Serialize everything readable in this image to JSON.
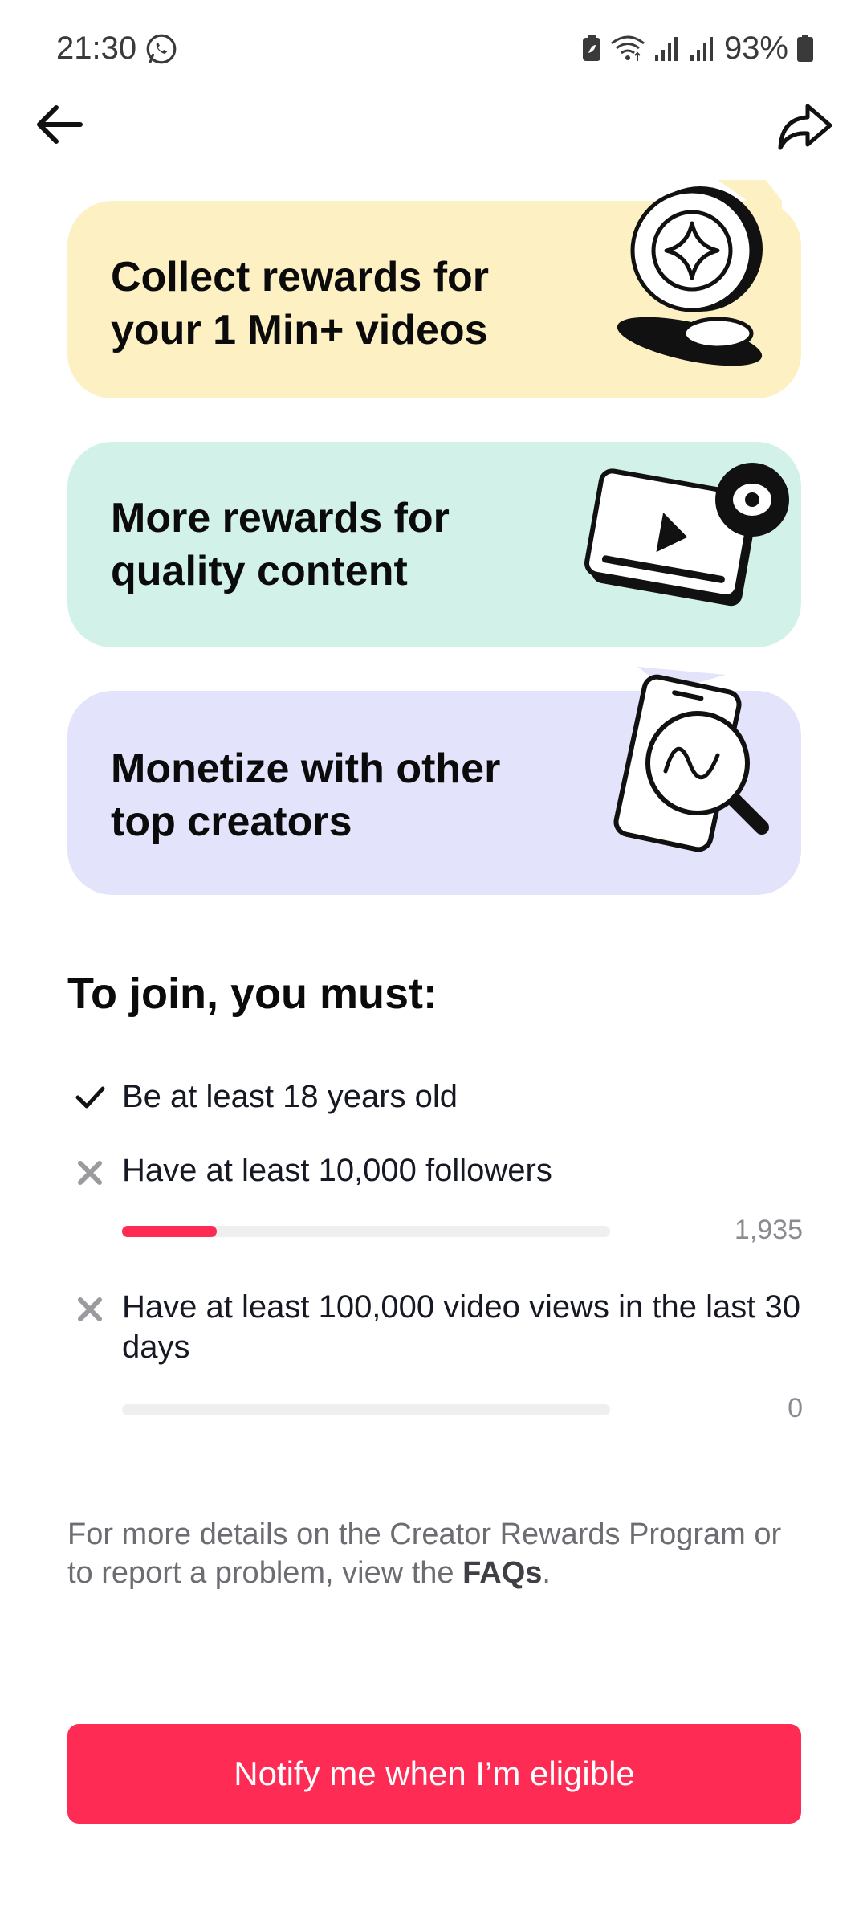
{
  "status_bar": {
    "time": "21:30",
    "battery": "93%",
    "icons": [
      "whatsapp-icon",
      "battery-saver-icon",
      "wifi-icon",
      "signal-icon",
      "signal-icon",
      "battery-icon"
    ]
  },
  "nav": {
    "back_icon": "arrow-left-icon",
    "share_icon": "share-arrow-icon"
  },
  "cards": [
    {
      "title": "Collect rewards for your 1 Min+ videos",
      "color": "#fdf0c3",
      "illustration": "coins-icon"
    },
    {
      "title": "More rewards for quality content",
      "color": "#d2f2e9",
      "illustration": "video-eye-icon"
    },
    {
      "title": "Monetize with other top creators",
      "color": "#e3e3fb",
      "illustration": "phone-magnifier-icon"
    }
  ],
  "requirements": {
    "title": "To join, you must:",
    "items": [
      {
        "text": "Be at least 18 years old",
        "status": "met",
        "icon": "check-icon"
      },
      {
        "text": "Have at least 10,000 followers",
        "status": "unmet",
        "icon": "cross-icon",
        "progress_value": "1,935",
        "progress_fraction": 0.1935
      },
      {
        "text": "Have at least 100,000 video views in the last 30 days",
        "status": "unmet",
        "icon": "cross-icon",
        "progress_value": "0",
        "progress_fraction": 0
      }
    ]
  },
  "footer": {
    "text_before": "For more details on the Creator Rewards Program or to report a problem, view the ",
    "link_text": "FAQs",
    "text_after": "."
  },
  "cta": {
    "label": "Notify me when I’m eligible"
  },
  "colors": {
    "accent": "#fe2c55",
    "track": "#efefef"
  }
}
